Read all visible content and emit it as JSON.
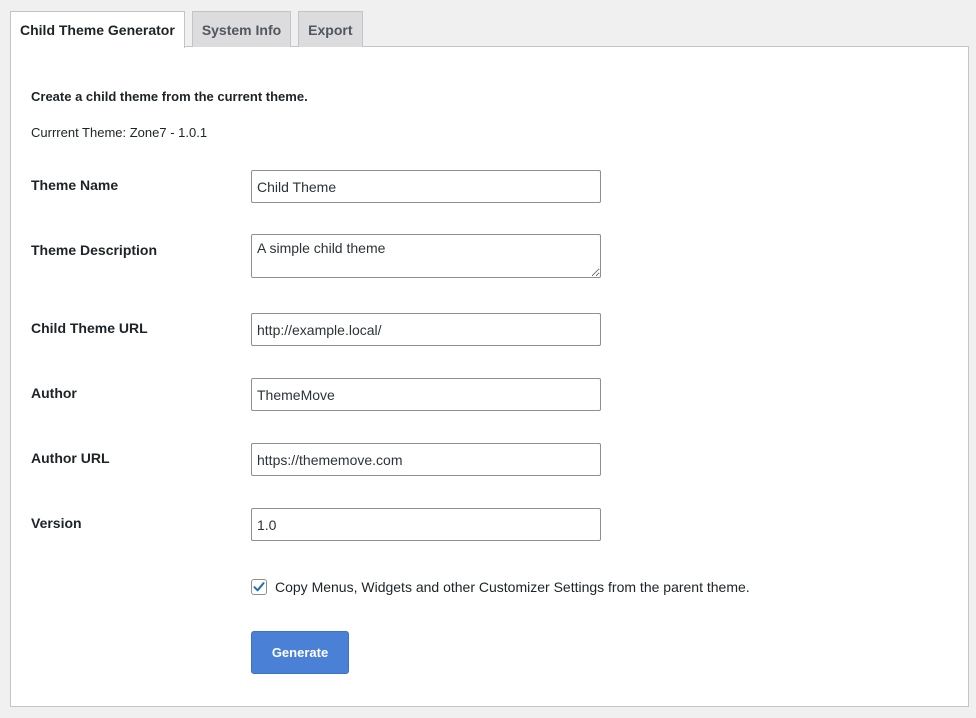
{
  "tabs": [
    {
      "label": "Child Theme Generator",
      "active": true
    },
    {
      "label": "System Info",
      "active": false
    },
    {
      "label": "Export",
      "active": false
    }
  ],
  "intro_text": "Create a child theme from the current theme.",
  "current_theme_text": "Currrent Theme: Zone7 - 1.0.1",
  "form": {
    "theme_name": {
      "label": "Theme Name",
      "value": "Child Theme"
    },
    "theme_description": {
      "label": "Theme Description",
      "value": "A simple child theme"
    },
    "child_theme_url": {
      "label": "Child Theme URL",
      "value": "http://example.local/"
    },
    "author": {
      "label": "Author",
      "value": "ThemeMove"
    },
    "author_url": {
      "label": "Author URL",
      "value": "https://thememove.com"
    },
    "version": {
      "label": "Version",
      "value": "1.0"
    },
    "copy_settings": {
      "label": "Copy Menus, Widgets and other Customizer Settings from the parent theme.",
      "checked": true
    },
    "generate_label": "Generate"
  },
  "colors": {
    "accent": "#4a80d6",
    "checkmark": "#2271b1",
    "background": "#f0f0f1"
  },
  "icons": {
    "checkmark": "checkmark-icon"
  }
}
